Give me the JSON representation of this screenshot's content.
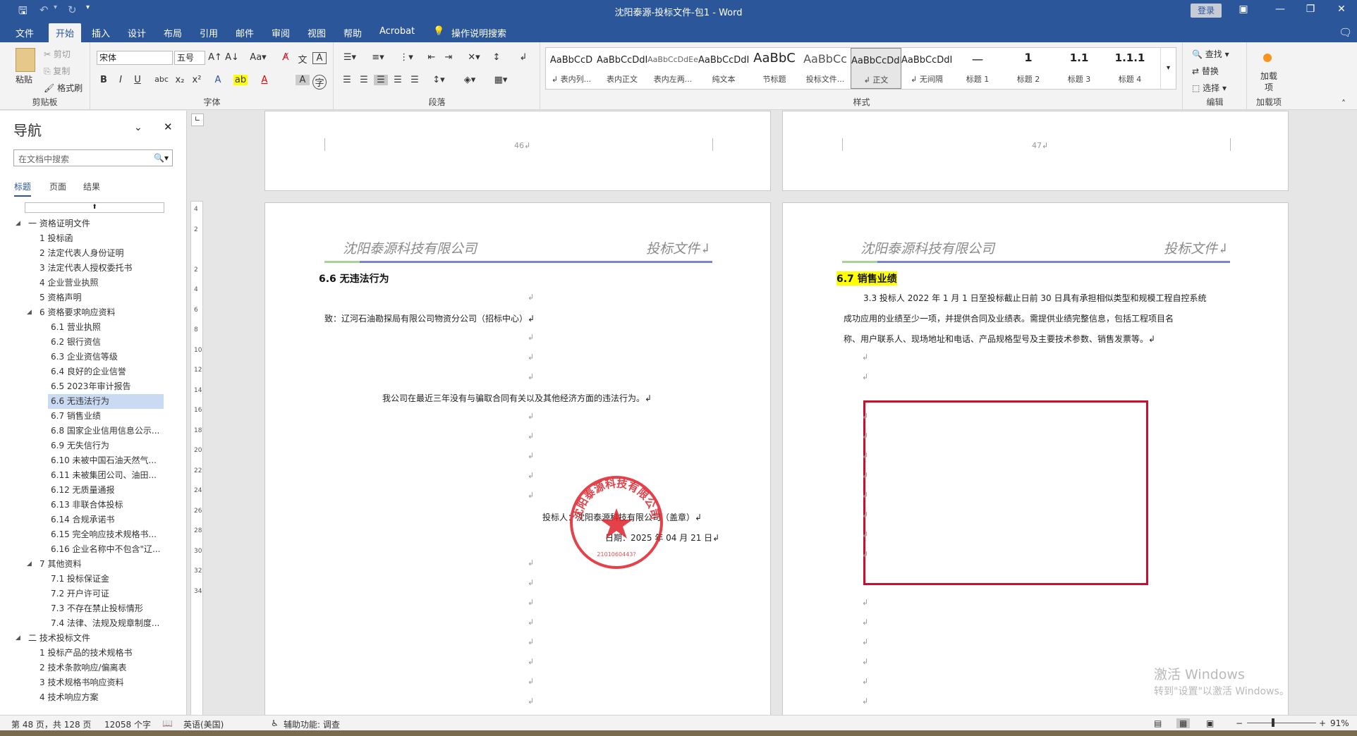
{
  "title_bar": {
    "title": "沈阳泰源-投标文件-包1  -  Word",
    "login": "登录"
  },
  "tabs": [
    "文件",
    "开始",
    "插入",
    "设计",
    "布局",
    "引用",
    "邮件",
    "审阅",
    "视图",
    "帮助",
    "Acrobat",
    "操作说明搜索"
  ],
  "ribbon": {
    "clipboard": {
      "paste": "粘贴",
      "cut": "剪切",
      "copy": "复制",
      "painter": "格式刷",
      "label": "剪贴板"
    },
    "font": {
      "name": "宋体",
      "size": "五号",
      "label": "字体"
    },
    "paragraph": {
      "label": "段落"
    },
    "styles": {
      "label": "样式",
      "items": [
        {
          "preview": "AaBbCcD",
          "name": "↲ 表内列..."
        },
        {
          "preview": "AaBbCcDdI",
          "name": "表内正文"
        },
        {
          "preview": "AaBbCcDdEe",
          "name": "表内左两..."
        },
        {
          "preview": "AaBbCcDdI",
          "name": "纯文本"
        },
        {
          "preview": "AaBbC",
          "name": "节标题"
        },
        {
          "preview": "AaBbCc",
          "name": "投标文件..."
        },
        {
          "preview": "AaBbCcDdI",
          "name": "↲ 正文"
        },
        {
          "preview": "AaBbCcDdI",
          "name": "↲ 无间隔"
        },
        {
          "preview": "一",
          "name": "标题 1"
        },
        {
          "preview": "1",
          "name": "标题 2"
        },
        {
          "preview": "1.1",
          "name": "标题 3"
        },
        {
          "preview": "1.1.1",
          "name": "标题 4"
        }
      ]
    },
    "editing": {
      "find": "查找",
      "replace": "替换",
      "select": "选择",
      "label": "编辑"
    },
    "addins": {
      "load": "加载项",
      "label": "加载项"
    }
  },
  "nav": {
    "title": "导航",
    "search_placeholder": "在文档中搜索",
    "tabs": [
      "标题",
      "页面",
      "结果"
    ],
    "items": [
      {
        "text": "一 资格证明文件",
        "level": 0,
        "expanded": true
      },
      {
        "text": "1 投标函",
        "level": 1
      },
      {
        "text": "2 法定代表人身份证明",
        "level": 1
      },
      {
        "text": "3 法定代表人授权委托书",
        "level": 1
      },
      {
        "text": "4 企业营业执照",
        "level": 1
      },
      {
        "text": "5 资格声明",
        "level": 1
      },
      {
        "text": "6 资格要求响应资料",
        "level": 1,
        "expanded": true
      },
      {
        "text": "6.1 营业执照",
        "level": 2
      },
      {
        "text": "6.2 银行资信",
        "level": 2
      },
      {
        "text": "6.3 企业资信等级",
        "level": 2
      },
      {
        "text": "6.4 良好的企业信誉",
        "level": 2
      },
      {
        "text": "6.5 2023年审计报告",
        "level": 2
      },
      {
        "text": "6.6 无违法行为",
        "level": 2,
        "selected": true
      },
      {
        "text": "6.7 销售业绩",
        "level": 2
      },
      {
        "text": "6.8 国家企业信用信息公示...",
        "level": 2
      },
      {
        "text": "6.9 无失信行为",
        "level": 2
      },
      {
        "text": "6.10 未被中国石油天然气...",
        "level": 2
      },
      {
        "text": "6.11 未被集团公司、油田...",
        "level": 2
      },
      {
        "text": "6.12 无质量通报",
        "level": 2
      },
      {
        "text": "6.13 非联合体投标",
        "level": 2
      },
      {
        "text": "6.14 合规承诺书",
        "level": 2
      },
      {
        "text": "6.15 完全响应技术规格书...",
        "level": 2
      },
      {
        "text": "6.16 企业名称中不包含\"辽...",
        "level": 2
      },
      {
        "text": "7 其他资料",
        "level": 1,
        "expanded": true
      },
      {
        "text": "7.1 投标保证金",
        "level": 2
      },
      {
        "text": "7.2 开户许可证",
        "level": 2
      },
      {
        "text": "7.3 不存在禁止投标情形",
        "level": 2
      },
      {
        "text": "7.4 法律、法规及规章制度...",
        "level": 2
      },
      {
        "text": "二 技术投标文件",
        "level": 0,
        "expanded": true
      },
      {
        "text": "1 投标产品的技术规格书",
        "level": 1
      },
      {
        "text": "2 技术条款响应/偏离表",
        "level": 1
      },
      {
        "text": "3 技术规格书响应资料",
        "level": 1
      },
      {
        "text": "4 技术响应方案",
        "level": 1
      }
    ]
  },
  "pages": {
    "page46_number": "46↲",
    "page47_number": "47↲",
    "header_company": "沈阳泰源科技有限公司",
    "header_doc": "投标文件↲",
    "left": {
      "heading": "6.6 无违法行为",
      "to": "致：辽河石油勘探局有限公司物资分公司（招标中心）↲",
      "statement": "我公司在最近三年没有与骗取合同有关以及其他经济方面的违法行为。↲",
      "bidder": "投标人：沈阳泰源科技有限公司（盖章）↲",
      "date": "日期：2025 年 04 月 21 日↲",
      "stamp_text": "沈阳泰源科技有限公司",
      "stamp_code": "2101060443?"
    },
    "right": {
      "heading": "6.7 销售业绩",
      "line1": "3.3 投标人 2022 年 1 月 1 日至投标截止日前 30 日具有承担相似类型和规模工程自控系统",
      "line2": "成功应用的业绩至少一项，并提供合同及业绩表。需提供业绩完整信息，包括工程项目名",
      "line3": "称、用户联系人、现场地址和电话、产品规格型号及主要技术参数、销售发票等。↲"
    }
  },
  "status": {
    "page": "第 48 页，共 128 页",
    "words": "12058 个字",
    "lang": "英语(美国)",
    "access": "辅助功能: 调查",
    "zoom": "91%"
  },
  "watermark": {
    "line1": "激活 Windows",
    "line2": "转到\"设置\"以激活 Windows。"
  }
}
